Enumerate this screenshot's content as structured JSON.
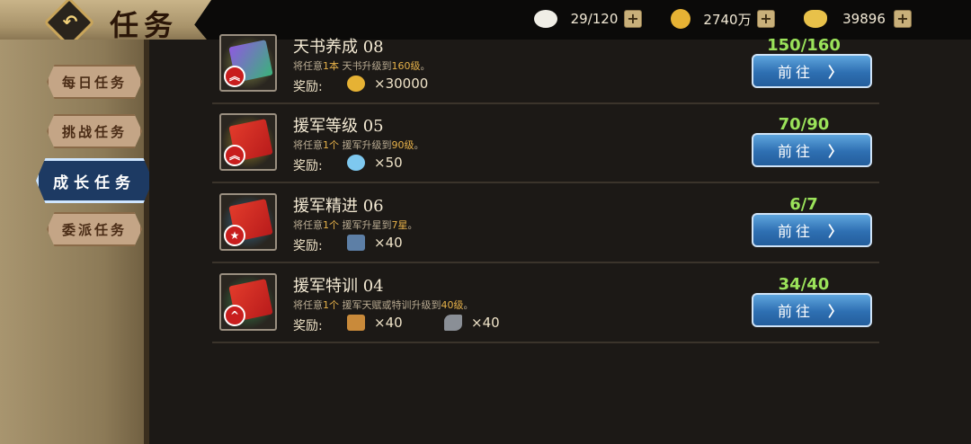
{
  "header": {
    "title": "任务",
    "back_glyph": "↶"
  },
  "resources": [
    {
      "icon": "bun-icon",
      "value": "29/120",
      "color": "#f0eee6"
    },
    {
      "icon": "coin-icon",
      "value": "2740万",
      "color": "#e6b234"
    },
    {
      "icon": "ingot-icon",
      "value": "39896",
      "color": "#e8c14a"
    }
  ],
  "plus_glyph": "+",
  "sidebar": {
    "tabs": [
      {
        "label": "每日任务",
        "active": false
      },
      {
        "label": "挑战任务",
        "active": false
      },
      {
        "label": "成长任务",
        "active": true
      },
      {
        "label": "委派任务",
        "active": false
      }
    ]
  },
  "tasks": [
    {
      "name": "天书养成 08",
      "desc_pre": "将任意",
      "desc_hl1": "1本",
      "desc_mid": "天书升级到",
      "desc_hl2": "160级",
      "desc_post": "。",
      "reward_label": "奖励:",
      "rewards": [
        {
          "icon": "coin-icon",
          "qty": "×30000",
          "color": "#e6b234"
        }
      ],
      "progress": "150/160",
      "go_label": "前往",
      "go_glyph": "〉"
    },
    {
      "name": "援军等级 05",
      "desc_pre": "将任意",
      "desc_hl1": "1个",
      "desc_mid": "援军升级到",
      "desc_hl2": "90级",
      "desc_post": "。",
      "reward_label": "奖励:",
      "rewards": [
        {
          "icon": "crystal-orb-icon",
          "qty": "×50",
          "color": "#7ec8ef"
        }
      ],
      "progress": "70/90",
      "go_label": "前往",
      "go_glyph": "〉"
    },
    {
      "name": "援军精进 06",
      "desc_pre": "将任意",
      "desc_hl1": "1个",
      "desc_mid": "援军升星到",
      "desc_hl2": "7星",
      "desc_post": "。",
      "reward_label": "奖励:",
      "rewards": [
        {
          "icon": "soldier-icon",
          "qty": "×40",
          "color": "#5d7fa6"
        }
      ],
      "progress": "6/7",
      "go_label": "前往",
      "go_glyph": "〉"
    },
    {
      "name": "援军特训 04",
      "desc_pre": "将任意",
      "desc_hl1": "1个",
      "desc_mid": "援军天赋或特训升级到",
      "desc_hl2": "40级",
      "desc_post": "。",
      "reward_label": "奖励:",
      "rewards": [
        {
          "icon": "supply-box-icon",
          "qty": "×40",
          "color": "#c98a3a"
        },
        {
          "icon": "horse-icon",
          "qty": "×40",
          "color": "#8a8f96"
        }
      ],
      "progress": "34/40",
      "go_label": "前往",
      "go_glyph": "〉"
    }
  ],
  "colors": {
    "accent_blue": "#2e6fb2",
    "progress_green": "#9be35a",
    "highlight_gold": "#e7b24a"
  }
}
